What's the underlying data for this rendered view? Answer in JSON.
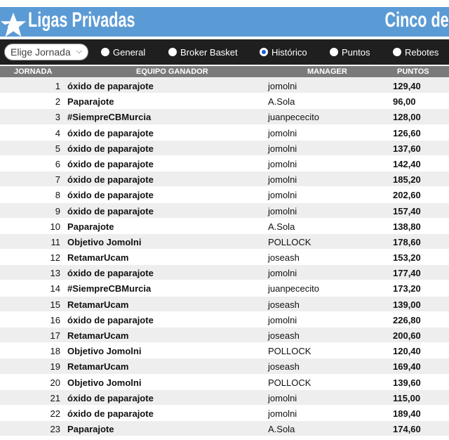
{
  "banner": {
    "title": "Ligas Privadas",
    "right_text": "Cinco de"
  },
  "filters": {
    "select_value": "Elige Jornada",
    "options": [
      {
        "label": "General",
        "selected": false
      },
      {
        "label": "Broker Basket",
        "selected": false
      },
      {
        "label": "Histórico",
        "selected": true
      },
      {
        "label": "Puntos",
        "selected": false
      },
      {
        "label": "Rebotes",
        "selected": false
      }
    ]
  },
  "table": {
    "headers": {
      "jornada": "JORNADA",
      "equipo": "EQUIPO GANADOR",
      "manager": "MANAGER",
      "puntos": "PUNTOS"
    },
    "rows": [
      {
        "num": "1",
        "team": "óxido de paparajote",
        "manager": "jomolni",
        "points": "129,40"
      },
      {
        "num": "2",
        "team": "Paparajote",
        "manager": "A.Sola",
        "points": "96,00"
      },
      {
        "num": "3",
        "team": "#SiempreCBMurcia",
        "manager": "juanpececito",
        "points": "128,00"
      },
      {
        "num": "4",
        "team": "óxido de paparajote",
        "manager": "jomolni",
        "points": "126,60"
      },
      {
        "num": "5",
        "team": "óxido de paparajote",
        "manager": "jomolni",
        "points": "137,60"
      },
      {
        "num": "6",
        "team": "óxido de paparajote",
        "manager": "jomolni",
        "points": "142,40"
      },
      {
        "num": "7",
        "team": "óxido de paparajote",
        "manager": "jomolni",
        "points": "185,20"
      },
      {
        "num": "8",
        "team": "óxido de paparajote",
        "manager": "jomolni",
        "points": "202,60"
      },
      {
        "num": "9",
        "team": "óxido de paparajote",
        "manager": "jomolni",
        "points": "157,40"
      },
      {
        "num": "10",
        "team": "Paparajote",
        "manager": "A.Sola",
        "points": "138,80"
      },
      {
        "num": "11",
        "team": "Objetivo Jomolni",
        "manager": "POLLOCK",
        "points": "178,60"
      },
      {
        "num": "12",
        "team": "RetamarUcam",
        "manager": "joseash",
        "points": "153,20"
      },
      {
        "num": "13",
        "team": "óxido de paparajote",
        "manager": "jomolni",
        "points": "177,40"
      },
      {
        "num": "14",
        "team": "#SiempreCBMurcia",
        "manager": "juanpececito",
        "points": "173,20"
      },
      {
        "num": "15",
        "team": "RetamarUcam",
        "manager": "joseash",
        "points": "139,00"
      },
      {
        "num": "16",
        "team": "óxido de paparajote",
        "manager": "jomolni",
        "points": "226,80"
      },
      {
        "num": "17",
        "team": "RetamarUcam",
        "manager": "joseash",
        "points": "200,60"
      },
      {
        "num": "18",
        "team": "Objetivo Jomolni",
        "manager": "POLLOCK",
        "points": "120,40"
      },
      {
        "num": "19",
        "team": "RetamarUcam",
        "manager": "joseash",
        "points": "169,40"
      },
      {
        "num": "20",
        "team": "Objetivo Jomolni",
        "manager": "POLLOCK",
        "points": "139,60"
      },
      {
        "num": "21",
        "team": "óxido de paparajote",
        "manager": "jomolni",
        "points": "115,00"
      },
      {
        "num": "22",
        "team": "óxido de paparajote",
        "manager": "jomolni",
        "points": "189,40"
      },
      {
        "num": "23",
        "team": "Paparajote",
        "manager": "A.Sola",
        "points": "174,60"
      }
    ]
  },
  "colors": {
    "banner": "#5b9bd5",
    "filterbar": "#1f1f1f",
    "header": "#7a7a7a",
    "row_alt": "#eeeeee",
    "radio_selected": "#1a5fd6"
  }
}
